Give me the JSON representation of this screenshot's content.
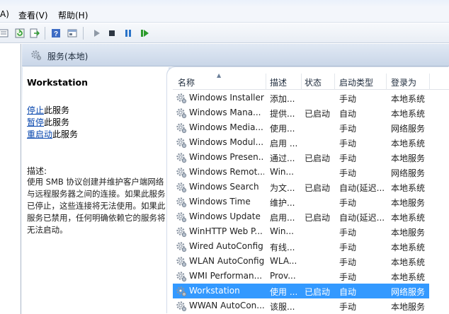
{
  "menu": {
    "items": [
      "A)",
      "查看(V)",
      "帮助(H)"
    ]
  },
  "toolbar": {
    "icons": [
      "list-icon",
      "refresh-icon",
      "export-icon",
      "help-icon",
      "properties-icon",
      "play-icon",
      "stop-icon",
      "pause-icon",
      "restart-icon"
    ]
  },
  "header": {
    "title": "服务(本地)"
  },
  "details": {
    "service_name": "Workstation",
    "action_stop_link": "停止",
    "action_stop_suffix": "此服务",
    "action_pause_link": "暂停",
    "action_pause_suffix": "此服务",
    "action_restart_link": "重启动",
    "action_restart_suffix": "此服务",
    "description_label": "描述:",
    "description": "使用 SMB 协议创建并维护客户端网络与远程服务器之间的连接。如果此服务已停止，这些连接将无法使用。如果此服务已禁用，任何明确依赖它的服务将无法启动。"
  },
  "columns": {
    "name": "名称",
    "desc": "描述",
    "status": "状态",
    "startup": "启动类型",
    "logon": "登录为"
  },
  "rows": [
    {
      "name": "Windows Installer",
      "desc": "添加...",
      "status": "",
      "startup": "手动",
      "logon": "本地系统"
    },
    {
      "name": "Windows Mana...",
      "desc": "提供...",
      "status": "已启动",
      "startup": "自动",
      "logon": "本地系统"
    },
    {
      "name": "Windows Media...",
      "desc": "使用...",
      "status": "",
      "startup": "手动",
      "logon": "网络服务"
    },
    {
      "name": "Windows Modul...",
      "desc": "启用 ...",
      "status": "",
      "startup": "手动",
      "logon": "本地系统"
    },
    {
      "name": "Windows Presen...",
      "desc": "通过...",
      "status": "已启动",
      "startup": "手动",
      "logon": "本地服务"
    },
    {
      "name": "Windows Remot...",
      "desc": "Win...",
      "status": "",
      "startup": "手动",
      "logon": "网络服务"
    },
    {
      "name": "Windows Search",
      "desc": "为文...",
      "status": "已启动",
      "startup": "自动(延迟...",
      "logon": "本地系统"
    },
    {
      "name": "Windows Time",
      "desc": "维护...",
      "status": "",
      "startup": "手动",
      "logon": "本地服务"
    },
    {
      "name": "Windows Update",
      "desc": "启用...",
      "status": "已启动",
      "startup": "自动(延迟...",
      "logon": "本地系统"
    },
    {
      "name": "WinHTTP Web P...",
      "desc": "Win...",
      "status": "",
      "startup": "手动",
      "logon": "本地服务"
    },
    {
      "name": "Wired AutoConfig",
      "desc": "有线...",
      "status": "",
      "startup": "手动",
      "logon": "本地系统"
    },
    {
      "name": "WLAN AutoConfig",
      "desc": "WLA...",
      "status": "",
      "startup": "手动",
      "logon": "本地系统"
    },
    {
      "name": "WMI Performan...",
      "desc": "Prov...",
      "status": "",
      "startup": "手动",
      "logon": "本地系统"
    },
    {
      "name": "Workstation",
      "desc": "使用 ...",
      "status": "已启动",
      "startup": "自动",
      "logon": "网络服务"
    },
    {
      "name": "WWAN AutoCon...",
      "desc": "该服...",
      "status": "",
      "startup": "手动",
      "logon": "本地服务"
    }
  ],
  "selected_row": 13,
  "colors": {
    "selection": "#3399ff",
    "link": "#0645ad"
  }
}
